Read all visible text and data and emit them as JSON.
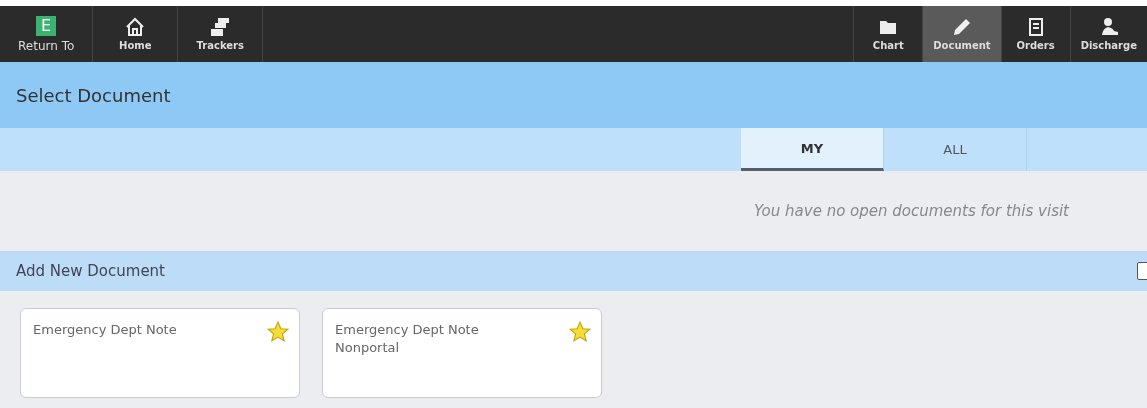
{
  "nav_left": [
    {
      "label": "Return To",
      "kind": "logo",
      "logo_letter": "E"
    },
    {
      "label": "Home",
      "kind": "home"
    },
    {
      "label": "Trackers",
      "kind": "trackers"
    }
  ],
  "nav_right": [
    {
      "label": "Chart",
      "kind": "chart",
      "selected": false
    },
    {
      "label": "Document",
      "kind": "document",
      "selected": true
    },
    {
      "label": "Orders",
      "kind": "orders",
      "selected": false
    },
    {
      "label": "Discharge",
      "kind": "discharge",
      "selected": false
    }
  ],
  "title": "Select Document",
  "tabs": [
    {
      "label": "MY",
      "selected": true
    },
    {
      "label": "ALL",
      "selected": false
    }
  ],
  "empty_message": "You have no open documents for this visit",
  "add_section": {
    "title": "Add New Document",
    "checkbox_checked": false
  },
  "cards": [
    {
      "title": "Emergency Dept Note",
      "favorite": true
    },
    {
      "title": "Emergency Dept Note Nonportal",
      "favorite": true
    }
  ]
}
